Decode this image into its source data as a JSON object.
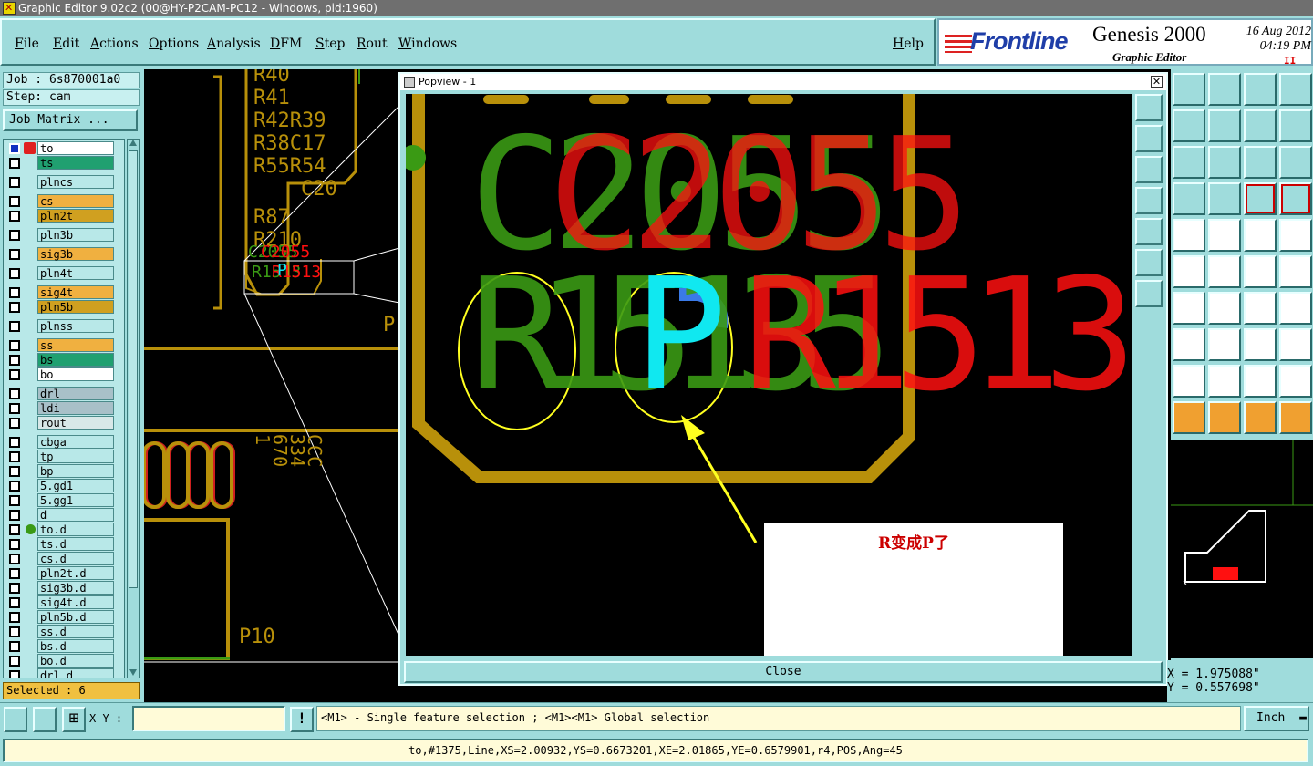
{
  "window": {
    "title": "Graphic Editor 9.02c2 (00@HY-P2CAM-PC12 - Windows, pid:1960)"
  },
  "menu": {
    "items": [
      "File",
      "Edit",
      "Actions",
      "Options",
      "Analysis",
      "DFM",
      "Step",
      "Rout",
      "Windows"
    ],
    "help": "Help"
  },
  "brand": {
    "logo": "Frontline",
    "product": "Genesis 2000",
    "subtitle": "Graphic Editor",
    "date": "16 Aug 2012",
    "time": "04:19 PM",
    "indicator": "II"
  },
  "job": {
    "label": "Job : 6s870001a0",
    "step": "Step: cam",
    "matrix_button": "Job Matrix ..."
  },
  "layers": [
    {
      "name": "to",
      "color": "#ffffff",
      "group": 0,
      "work": true
    },
    {
      "name": "ts",
      "color": "#20a070",
      "group": 0
    },
    {
      "name": "plncs",
      "color": "#b8e8e8",
      "group": 1
    },
    {
      "name": "cs",
      "color": "#f0b040",
      "group": 2
    },
    {
      "name": "pln2t",
      "color": "#d0a020",
      "group": 2
    },
    {
      "name": "pln3b",
      "color": "#b8e8e8",
      "group": 3
    },
    {
      "name": "sig3b",
      "color": "#f0b040",
      "group": 4
    },
    {
      "name": "pln4t",
      "color": "#b8e8e8",
      "group": 5
    },
    {
      "name": "sig4t",
      "color": "#f0b040",
      "group": 6
    },
    {
      "name": "pln5b",
      "color": "#d0a020",
      "group": 6
    },
    {
      "name": "plnss",
      "color": "#b8e8e8",
      "group": 7
    },
    {
      "name": "ss",
      "color": "#f0b040",
      "group": 8
    },
    {
      "name": "bs",
      "color": "#20a070",
      "group": 8
    },
    {
      "name": "bo",
      "color": "#ffffff",
      "group": 8
    },
    {
      "name": "drl",
      "color": "#a8c0c8",
      "group": 9
    },
    {
      "name": "ldi",
      "color": "#a8c0c8",
      "group": 9
    },
    {
      "name": "rout",
      "color": "#d8e8e8",
      "group": 9
    },
    {
      "name": "cbga",
      "color": "#b8e8e8",
      "group": 10
    },
    {
      "name": "tp",
      "color": "#b8e8e8",
      "group": 10
    },
    {
      "name": "bp",
      "color": "#b8e8e8",
      "group": 10
    },
    {
      "name": "5.gd1",
      "color": "#b8e8e8",
      "group": 10
    },
    {
      "name": "5.gg1",
      "color": "#b8e8e8",
      "group": 10
    },
    {
      "name": "d",
      "color": "#b8e8e8",
      "group": 10
    },
    {
      "name": "to.d",
      "color": "#b8e8e8",
      "group": 10,
      "dot": true
    },
    {
      "name": "ts.d",
      "color": "#b8e8e8",
      "group": 10
    },
    {
      "name": "cs.d",
      "color": "#b8e8e8",
      "group": 10
    },
    {
      "name": "pln2t.d",
      "color": "#b8e8e8",
      "group": 10
    },
    {
      "name": "sig3b.d",
      "color": "#b8e8e8",
      "group": 10
    },
    {
      "name": "sig4t.d",
      "color": "#b8e8e8",
      "group": 10
    },
    {
      "name": "pln5b.d",
      "color": "#b8e8e8",
      "group": 10
    },
    {
      "name": "ss.d",
      "color": "#b8e8e8",
      "group": 10
    },
    {
      "name": "bs.d",
      "color": "#b8e8e8",
      "group": 10
    },
    {
      "name": "bo.d",
      "color": "#b8e8e8",
      "group": 10
    },
    {
      "name": "drl.d",
      "color": "#b8e8e8",
      "group": 10
    }
  ],
  "selected": "Selected : 6",
  "popview": {
    "title": "Popview - 1",
    "close_label": "Close",
    "annotation": "R变成P了"
  },
  "canvas_labels": {
    "refdes": [
      "R40",
      "R41",
      "R42R39",
      "R38C17",
      "R55R54",
      "C20",
      "R87",
      "R210"
    ],
    "p_label": "P",
    "p10": "P10",
    "zoomed_green": "C2055",
    "zoomed_red": "C2055",
    "row2_green": "R15135",
    "row2_red": "R1513",
    "p_glyph": "P",
    "small_c": "C2055",
    "small_r": "R1513",
    "small_p": "P",
    "cap_labels": "CCC\n334\n670\n1"
  },
  "coords": {
    "x": "X = 1.975088\"",
    "y": "Y = 0.557698\""
  },
  "cmd": {
    "xy_label": "X Y :",
    "xy_value": "",
    "prompt": "<M1> - Single feature selection ; <M1><M1> Global selection",
    "units": "Inch"
  },
  "status": "to,#1375,Line,XS=2.00932,YS=0.6673201,XE=2.01865,YE=0.6579901,r4,POS,Ang=45",
  "colors": {
    "bg": "#9fdcdc",
    "board": "#b8900a",
    "green": "#3a9a14",
    "red": "#ff1010",
    "cyan": "#10e8f0",
    "yellow": "#ffff20"
  }
}
